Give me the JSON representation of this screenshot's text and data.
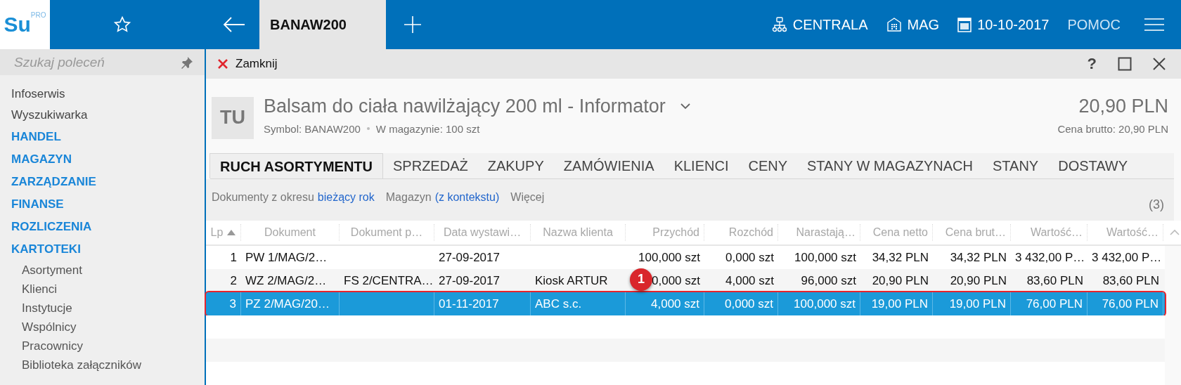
{
  "topbar": {
    "logo": {
      "main": "Su",
      "sup": "PRO"
    },
    "tabs": [
      {
        "label": "BANAW200",
        "selected": true
      }
    ],
    "context": [
      {
        "kind": "branch",
        "label": "CENTRALA"
      },
      {
        "kind": "warehouse",
        "label": "MAG"
      },
      {
        "kind": "date",
        "label": "10-10-2017"
      },
      {
        "kind": "help",
        "label": "POMOC"
      }
    ]
  },
  "sidebar": {
    "search": {
      "placeholder": "Szukaj poleceń"
    },
    "items": [
      {
        "kind": "plain",
        "label": "Infoserwis"
      },
      {
        "kind": "plain",
        "label": "Wyszukiwarka"
      },
      {
        "kind": "section",
        "label": "HANDEL"
      },
      {
        "kind": "section",
        "label": "MAGAZYN"
      },
      {
        "kind": "section",
        "label": "ZARZĄDZANIE"
      },
      {
        "kind": "section",
        "label": "FINANSE"
      },
      {
        "kind": "section",
        "label": "ROZLICZENIA"
      },
      {
        "kind": "section",
        "label": "KARTOTEKI",
        "children": [
          {
            "label": "Asortyment"
          },
          {
            "label": "Klienci"
          },
          {
            "label": "Instytucje"
          },
          {
            "label": "Wspólnicy"
          },
          {
            "label": "Pracownicy"
          },
          {
            "label": "Biblioteka załączników"
          }
        ]
      }
    ]
  },
  "toolbar": {
    "close_label": "Zamknij",
    "window_buttons": [
      "?"
    ]
  },
  "header": {
    "avatar": "TU",
    "title": "Balsam do ciała nawilżający 200 ml - Informator",
    "symbol": "Symbol: BANAW200",
    "stock": "W magazynie: 100 szt",
    "price": "20,90 PLN",
    "gross": "Cena brutto: 20,90 PLN"
  },
  "tabs": [
    {
      "label": "RUCH ASORTYMENTU",
      "selected": true
    },
    {
      "label": "SPRZEDAŻ",
      "selected": false
    },
    {
      "label": "ZAKUPY",
      "selected": false
    },
    {
      "label": "ZAMÓWIENIA",
      "selected": false
    },
    {
      "label": "KLIENCI",
      "selected": false
    },
    {
      "label": "CENY",
      "selected": false
    },
    {
      "label": "STANY W MAGAZYNACH",
      "selected": false
    },
    {
      "label": "STANY",
      "selected": false
    },
    {
      "label": "DOSTAWY",
      "selected": false
    }
  ],
  "filters": [
    {
      "label": "Dokumenty z okresu",
      "value": "bieżący rok"
    },
    {
      "label": "Magazyn",
      "value": "(z kontekstu)"
    },
    {
      "label": "Więcej"
    }
  ],
  "count": "(3)",
  "table": {
    "columns": [
      {
        "label": "Lp",
        "sorted": true
      },
      {
        "label": "Dokument",
        "sorted": false
      },
      {
        "label": "Dokument p…",
        "sorted": false
      },
      {
        "label": "Data wystawi…",
        "sorted": false
      },
      {
        "label": "Nazwa klienta",
        "sorted": false
      },
      {
        "label": "Przychód",
        "sorted": false
      },
      {
        "label": "Rozchód",
        "sorted": false
      },
      {
        "label": "Narastają…",
        "sorted": false
      },
      {
        "label": "Cena netto",
        "sorted": false
      },
      {
        "label": "Cena brut…",
        "sorted": false
      },
      {
        "label": "Wartość…",
        "sorted": false
      },
      {
        "label": "Wartość…",
        "sorted": false
      }
    ],
    "rows": [
      {
        "selected": false,
        "highlighted": false,
        "cells": [
          "1",
          "PW 1/MAG/2…",
          "",
          "27-09-2017",
          "",
          "100,000 szt",
          "0,000 szt",
          "100,000 szt",
          "34,32 PLN",
          "34,32 PLN",
          "3 432,00 P…",
          "3 432,00 P…"
        ]
      },
      {
        "selected": false,
        "highlighted": false,
        "cells": [
          "2",
          "WZ 2/MAG/2…",
          "FS 2/CENTRA…",
          "27-09-2017",
          "Kiosk ARTUR",
          "0,000 szt",
          "4,000 szt",
          "96,000 szt",
          "20,90 PLN",
          "20,90 PLN",
          "83,60 PLN",
          "83,60 PLN"
        ]
      },
      {
        "selected": true,
        "highlighted": true,
        "cells": [
          "3",
          "PZ 2/MAG/20…",
          "",
          "01-11-2017",
          "ABC s.c.",
          "4,000 szt",
          "0,000 szt",
          "100,000 szt",
          "19,00 PLN",
          "19,00 PLN",
          "76,00 PLN",
          "76,00 PLN"
        ]
      }
    ]
  },
  "callout": "1"
}
